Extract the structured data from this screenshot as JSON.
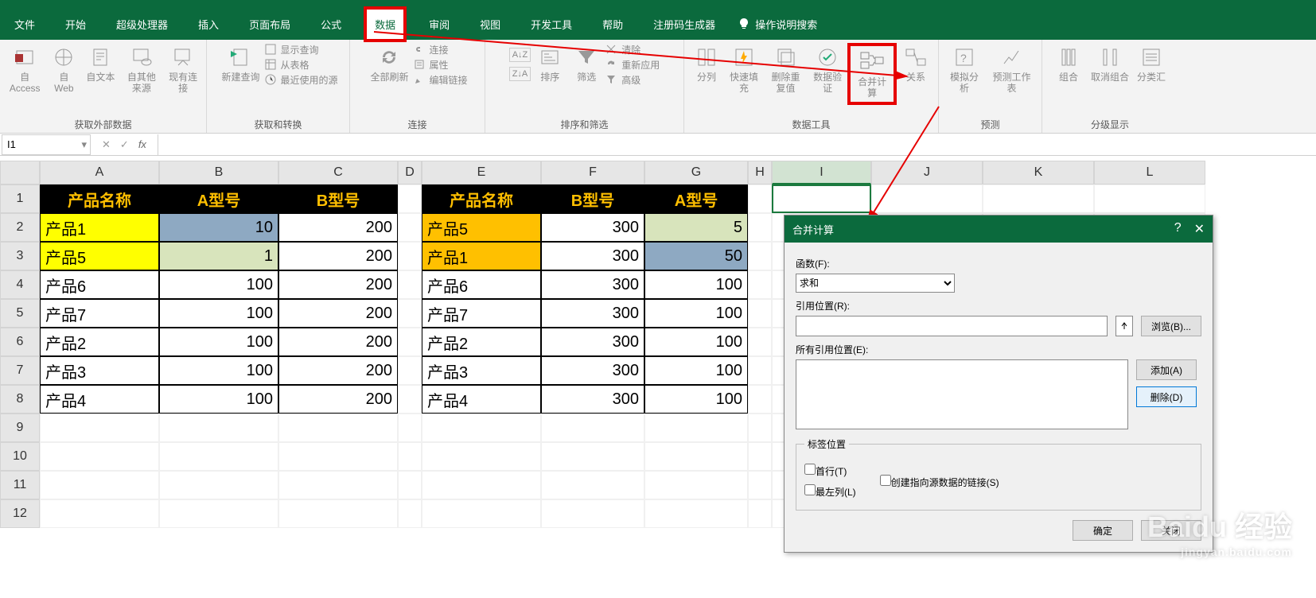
{
  "menubar": {
    "tabs": [
      "文件",
      "开始",
      "超级处理器",
      "插入",
      "页面布局",
      "公式",
      "数据",
      "审阅",
      "视图",
      "开发工具",
      "帮助",
      "注册码生成器"
    ],
    "active_index": 6,
    "search_label": "操作说明搜索"
  },
  "ribbon": {
    "groups": [
      {
        "label": "获取外部数据",
        "items": [
          "自 Access",
          "自 Web",
          "自文本",
          "自其他来源",
          "现有连接"
        ]
      },
      {
        "label": "获取和转换",
        "items": [
          "新建查询"
        ],
        "sub": [
          "显示查询",
          "从表格",
          "最近使用的源"
        ]
      },
      {
        "label": "连接",
        "items": [
          "全部刷新"
        ],
        "sub": [
          "连接",
          "属性",
          "编辑链接"
        ]
      },
      {
        "label": "排序和筛选",
        "items": [
          "排序",
          "筛选"
        ],
        "sub": [
          "清除",
          "重新应用",
          "高级"
        ]
      },
      {
        "label": "数据工具",
        "items": [
          "分列",
          "快速填充",
          "删除重复值",
          "数据验证",
          "合并计算",
          "关系"
        ]
      },
      {
        "label": "预测",
        "items": [
          "模拟分析",
          "预测工作表"
        ]
      },
      {
        "label": "分级显示",
        "items": [
          "组合",
          "取消组合",
          "分类汇"
        ]
      }
    ],
    "sort_icons": [
      "A↓Z",
      "Z↓A"
    ]
  },
  "namebox": {
    "value": "I1"
  },
  "columns": [
    "A",
    "B",
    "C",
    "D",
    "E",
    "F",
    "G",
    "H",
    "I",
    "J",
    "K",
    "L"
  ],
  "rows": [
    "1",
    "2",
    "3",
    "4",
    "5",
    "6",
    "7",
    "8",
    "9",
    "10",
    "11",
    "12"
  ],
  "table1": {
    "headers": [
      "产品名称",
      "A型号",
      "B型号"
    ],
    "rows": [
      {
        "name": "产品1",
        "a": "10",
        "b": "200",
        "name_bg": "yel",
        "a_bg": "blu"
      },
      {
        "name": "产品5",
        "a": "1",
        "b": "200",
        "name_bg": "yel",
        "a_bg": "grn"
      },
      {
        "name": "产品6",
        "a": "100",
        "b": "200"
      },
      {
        "name": "产品7",
        "a": "100",
        "b": "200"
      },
      {
        "name": "产品2",
        "a": "100",
        "b": "200"
      },
      {
        "name": "产品3",
        "a": "100",
        "b": "200"
      },
      {
        "name": "产品4",
        "a": "100",
        "b": "200"
      }
    ]
  },
  "table2": {
    "headers": [
      "产品名称",
      "B型号",
      "A型号"
    ],
    "rows": [
      {
        "name": "产品5",
        "b": "300",
        "a": "5",
        "name_bg": "orng",
        "a_bg": "grn"
      },
      {
        "name": "产品1",
        "b": "300",
        "a": "50",
        "name_bg": "orng",
        "a_bg": "blu"
      },
      {
        "name": "产品6",
        "b": "300",
        "a": "100"
      },
      {
        "name": "产品7",
        "b": "300",
        "a": "100"
      },
      {
        "name": "产品2",
        "b": "300",
        "a": "100"
      },
      {
        "name": "产品3",
        "b": "300",
        "a": "100"
      },
      {
        "name": "产品4",
        "b": "300",
        "a": "100"
      }
    ]
  },
  "dialog": {
    "title": "合并计算",
    "fn_label": "函数(F):",
    "fn_value": "求和",
    "ref_label": "引用位置(R):",
    "browse_btn": "浏览(B)...",
    "allref_label": "所有引用位置(E):",
    "add_btn": "添加(A)",
    "del_btn": "删除(D)",
    "labelpos": "标签位置",
    "top_row": "首行(T)",
    "left_col": "最左列(L)",
    "create_link": "创建指向源数据的链接(S)",
    "ok": "确定",
    "close": "关闭"
  },
  "watermark": {
    "main": "Baidu 经验",
    "sub": "jingyan.baidu.com"
  }
}
